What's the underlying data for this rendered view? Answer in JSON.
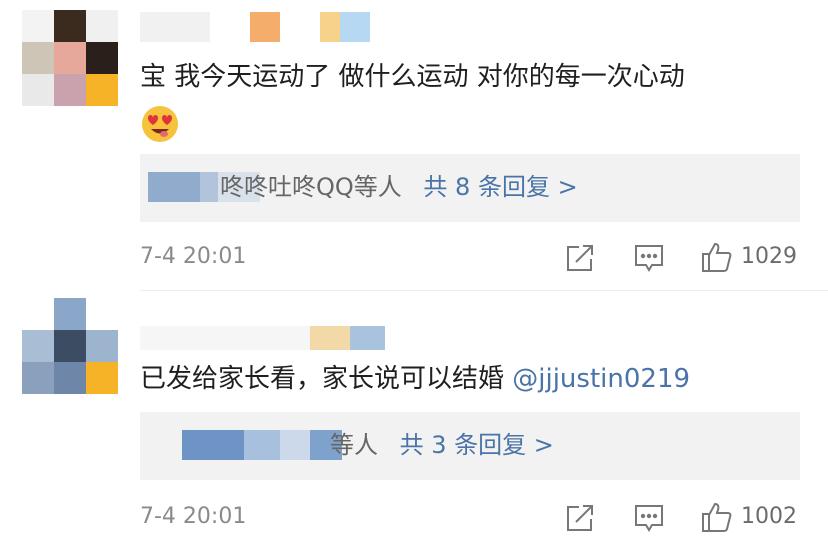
{
  "comments": [
    {
      "content": "宝 我今天运动了 做什么运动 对你的每一次心动",
      "has_emoji": true,
      "reply_preview_prefix": "咚咚吐咚QQ等人",
      "reply_link": "共 8 条回复 >",
      "timestamp": "7-4 20:01",
      "likes": "1029"
    },
    {
      "content": "已发给家长看，家长说可以结婚 ",
      "mention": "@jjjustin0219",
      "reply_preview_prefix": "等人",
      "reply_link": "共 3 条回复 >",
      "timestamp": "7-4 20:01",
      "likes": "1002"
    }
  ],
  "colors": {
    "accent": "#4a74a8",
    "reply_bg": "#f2f2f2",
    "muted": "#8a8a8a"
  },
  "icons": [
    "share-icon",
    "comment-icon",
    "like-icon",
    "heart-eyes-emoji"
  ]
}
